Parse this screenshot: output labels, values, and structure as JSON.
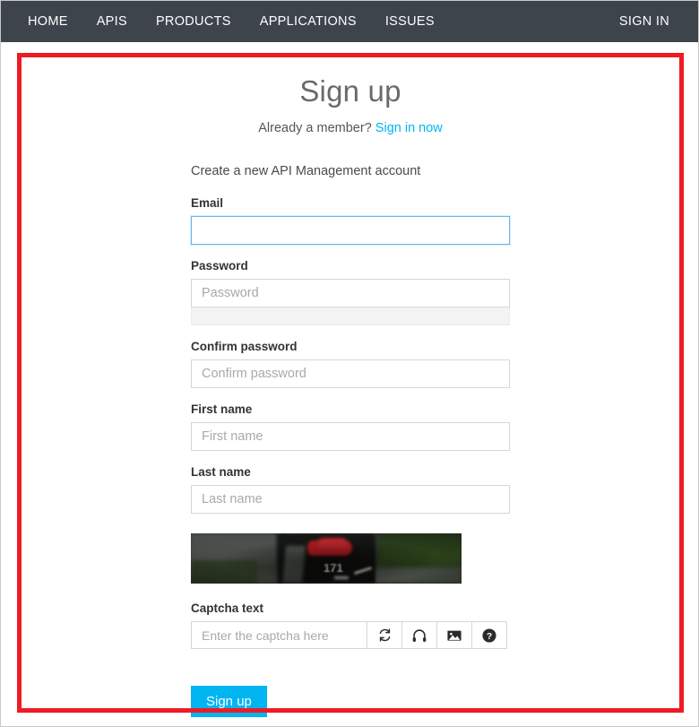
{
  "navbar": {
    "background": "#3e444c",
    "items": [
      {
        "label": "HOME",
        "name": "nav-item-home"
      },
      {
        "label": "APIS",
        "name": "nav-item-apis"
      },
      {
        "label": "PRODUCTS",
        "name": "nav-item-products"
      },
      {
        "label": "APPLICATIONS",
        "name": "nav-item-applications"
      },
      {
        "label": "ISSUES",
        "name": "nav-item-issues"
      }
    ],
    "sign_in": "SIGN IN"
  },
  "annotation": {
    "border_color": "#ed1c24"
  },
  "page": {
    "title": "Sign up",
    "subtitle_prefix": "Already a member?",
    "subtitle_link": "Sign in now",
    "link_color": "#00b5f0"
  },
  "form": {
    "intro": "Create a new API Management account",
    "fields": [
      {
        "name": "email",
        "label": "Email",
        "placeholder": "",
        "value": "",
        "focused": true,
        "has_strength_meter": false
      },
      {
        "name": "password",
        "label": "Password",
        "placeholder": "Password",
        "value": "",
        "focused": false,
        "has_strength_meter": true
      },
      {
        "name": "confirm-password",
        "label": "Confirm password",
        "placeholder": "Confirm password",
        "value": "",
        "focused": false,
        "has_strength_meter": false
      },
      {
        "name": "first-name",
        "label": "First name",
        "placeholder": "First name",
        "value": "",
        "focused": false,
        "has_strength_meter": false
      },
      {
        "name": "last-name",
        "label": "Last name",
        "placeholder": "Last name",
        "value": "",
        "focused": false,
        "has_strength_meter": false
      }
    ],
    "captcha": {
      "image_alt": "blurred street photo of a mailbox with a raised red flag and house number 171",
      "image_number": "171",
      "label": "Captcha text",
      "placeholder": "Enter the captcha here",
      "value": "",
      "buttons": [
        {
          "name": "captcha-refresh-button",
          "icon": "refresh-icon"
        },
        {
          "name": "captcha-audio-button",
          "icon": "headphones-icon"
        },
        {
          "name": "captcha-image-button",
          "icon": "image-icon"
        },
        {
          "name": "captcha-help-button",
          "icon": "help-icon"
        }
      ]
    },
    "submit_label": "Sign up",
    "submit_color": "#00b5f0"
  }
}
